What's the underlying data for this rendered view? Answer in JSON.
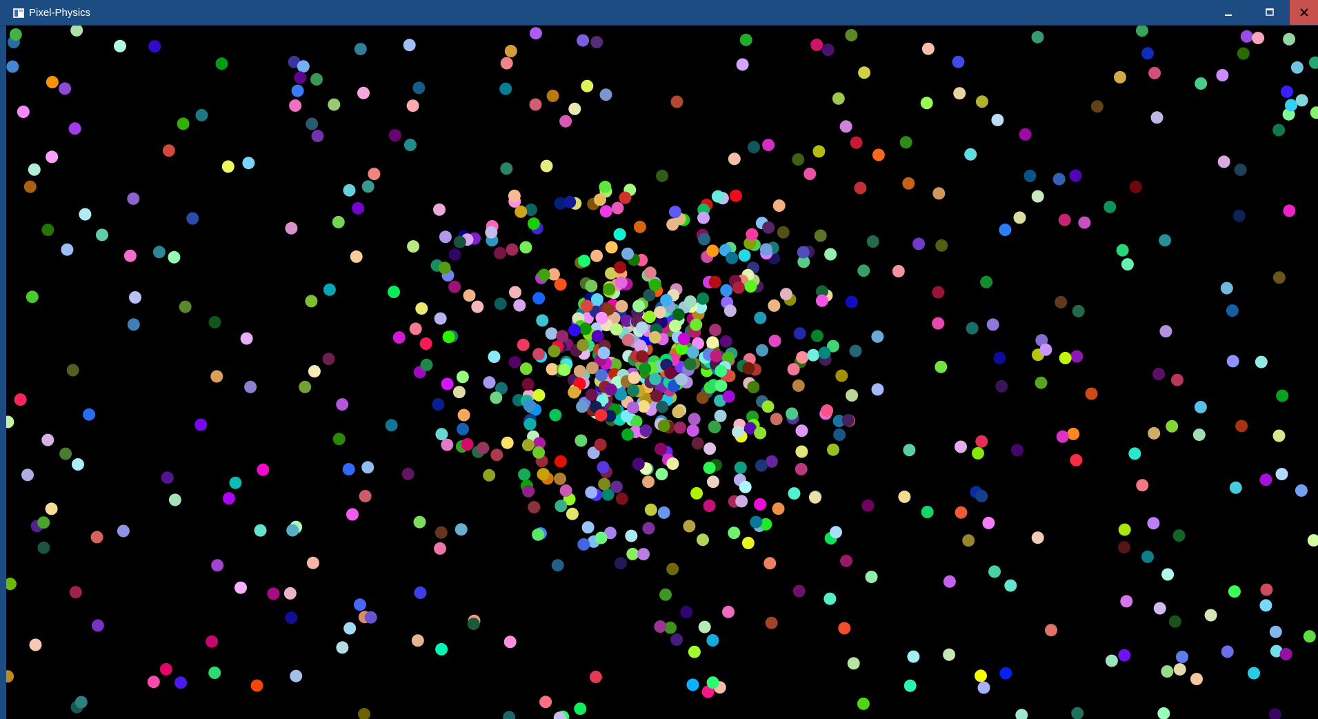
{
  "window": {
    "title": "Pixel-Physics",
    "title_bar_color": "#1c4c82",
    "close_button_color": "#c8514e",
    "controls": {
      "minimize_icon": "minimize-icon",
      "maximize_icon": "maximize-icon",
      "close_icon": "close-icon"
    }
  },
  "simulation": {
    "background_color": "#000000",
    "description_colors": [
      "#ff3b30",
      "#34c759",
      "#007aff",
      "#ffcc00",
      "#af52de",
      "#ff2d92",
      "#5ac8fa",
      "#a2845e",
      "#ff9500",
      "#30d158"
    ]
  }
}
